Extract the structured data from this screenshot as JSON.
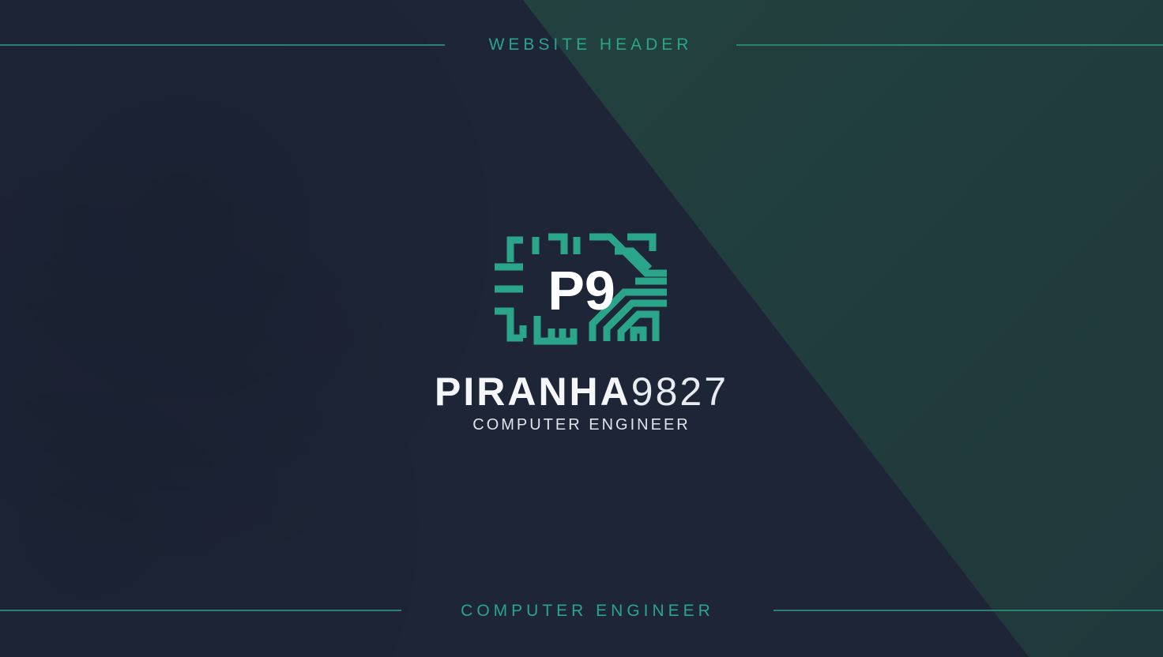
{
  "header": {
    "label": "WEBSITE HEADER"
  },
  "logo": {
    "monogram": "P9",
    "icon": "circuit-chip-icon"
  },
  "brand": {
    "name_bold": "PIRANHA",
    "name_light": "9827",
    "subtitle": "COMPUTER ENGINEER"
  },
  "footer": {
    "label": "COMPUTER ENGINEER"
  },
  "colors": {
    "background": "#1d2537",
    "diagonal_panel": "#213b3d",
    "accent": "#2aa58a",
    "text": "#ffffff"
  }
}
